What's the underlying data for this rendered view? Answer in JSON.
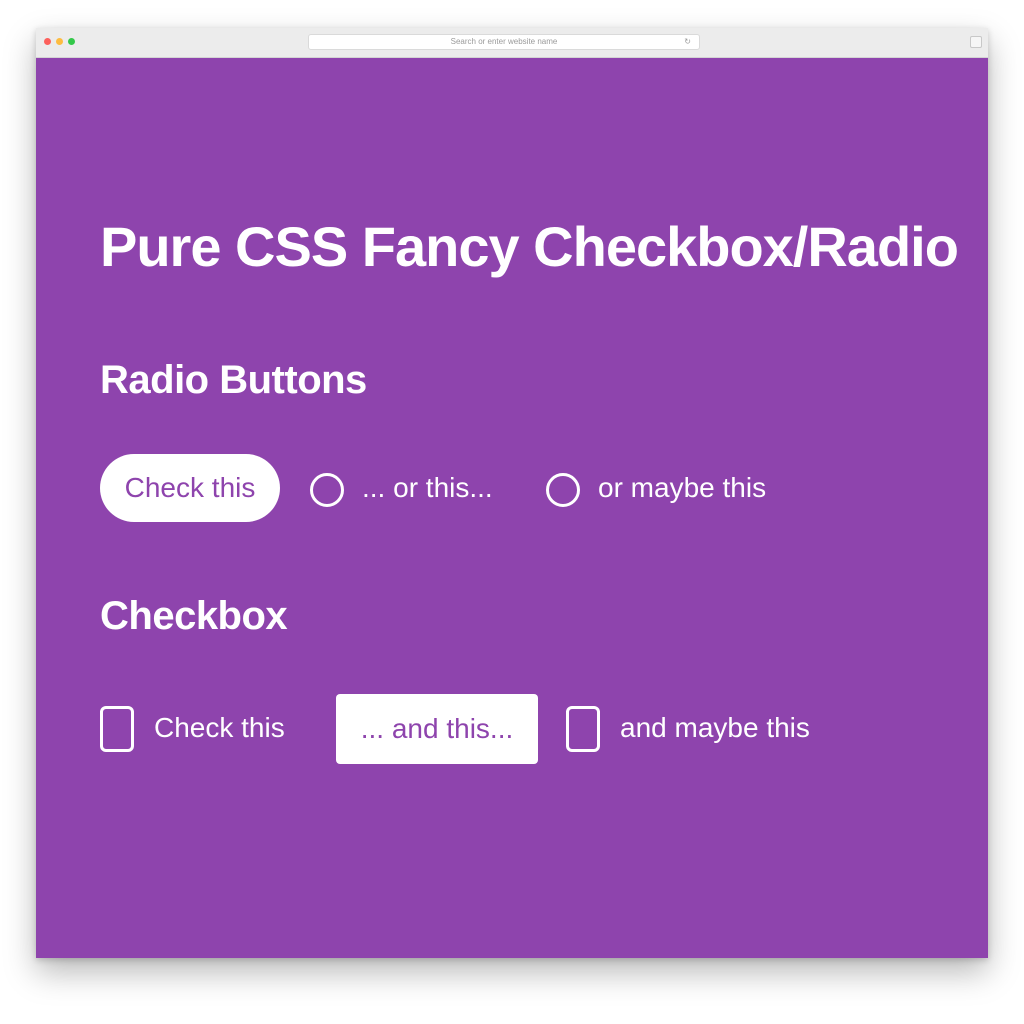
{
  "browser": {
    "url_text": "Search or enter website name",
    "reload_icon": "reload-icon"
  },
  "page": {
    "title": "Pure CSS Fancy Checkbox/Radio",
    "radio_heading": "Radio Buttons",
    "checkbox_heading": "Checkbox"
  },
  "radios": [
    {
      "label": "Check this",
      "checked": true
    },
    {
      "label": "... or this...",
      "checked": false
    },
    {
      "label": "or maybe this",
      "checked": false
    }
  ],
  "checkboxes": [
    {
      "label": "Check this",
      "checked": false
    },
    {
      "label": "... and this...",
      "checked": true
    },
    {
      "label": "and maybe this",
      "checked": false
    }
  ],
  "colors": {
    "background": "#8e44ad",
    "foreground": "#ffffff"
  }
}
